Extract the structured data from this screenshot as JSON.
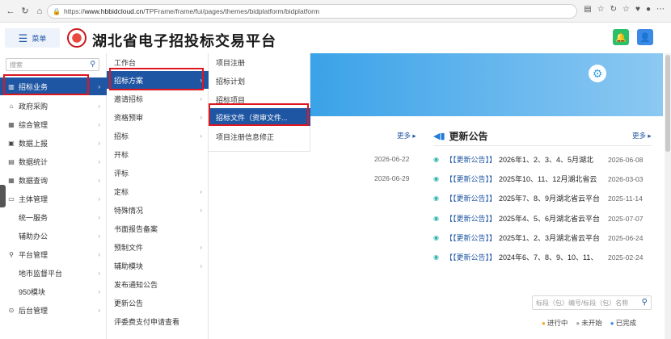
{
  "browser": {
    "nav": [
      "←",
      "↻",
      "⌂"
    ],
    "url_prefix": "https://",
    "url_host": "www.hbbidcloud.cn",
    "url_path": "/TPFrame/frame/fui/pages/themes/bidplatform/bidplatform",
    "right_icons": [
      "▤",
      "☆",
      "↻",
      "☆",
      "♥",
      "●",
      "⋯"
    ]
  },
  "header": {
    "menu_label": "菜单",
    "title": "湖北省电子招投标交易平台"
  },
  "sidebar": {
    "search_placeholder": "搜索",
    "items": [
      {
        "icon": "▥",
        "label": "招标业务",
        "arrow": "›",
        "active": true
      },
      {
        "icon": "⌂",
        "label": "政府采购",
        "arrow": "›"
      },
      {
        "icon": "▦",
        "label": "综合管理",
        "arrow": "›"
      },
      {
        "icon": "▣",
        "label": "数据上报",
        "arrow": "›"
      },
      {
        "icon": "▤",
        "label": "数据统计",
        "arrow": "›"
      },
      {
        "icon": "▦",
        "label": "数据查询",
        "arrow": "›"
      },
      {
        "icon": "▭",
        "label": "主体管理",
        "arrow": "›"
      },
      {
        "icon": "",
        "label": "统一服务",
        "arrow": "›",
        "sub": true
      },
      {
        "icon": "",
        "label": "辅助办公",
        "arrow": "›",
        "sub": true
      },
      {
        "icon": "⚲",
        "label": "平台管理",
        "arrow": "›"
      },
      {
        "icon": "",
        "label": "地市监督平台",
        "arrow": "›",
        "sub": true
      },
      {
        "icon": "",
        "label": "950模块",
        "arrow": "›",
        "sub": true
      },
      {
        "icon": "⊙",
        "label": "后台管理",
        "arrow": "›"
      }
    ]
  },
  "submenu": {
    "items": [
      {
        "label": "工作台",
        "arrow": ""
      },
      {
        "label": "招标方案",
        "arrow": "›",
        "active": true
      },
      {
        "label": "邀请招标",
        "arrow": "›"
      },
      {
        "label": "资格预审",
        "arrow": "›"
      },
      {
        "label": "招标",
        "arrow": "›"
      },
      {
        "label": "开标",
        "arrow": ""
      },
      {
        "label": "评标",
        "arrow": ""
      },
      {
        "label": "定标",
        "arrow": "›"
      },
      {
        "label": "特殊情况",
        "arrow": "›"
      },
      {
        "label": "书面报告备案",
        "arrow": ""
      },
      {
        "label": "预制文件",
        "arrow": "›"
      },
      {
        "label": "辅助模块",
        "arrow": "›"
      },
      {
        "label": "发布通知公告",
        "arrow": ""
      },
      {
        "label": "更新公告",
        "arrow": ""
      },
      {
        "label": "评委费支付申请查看",
        "arrow": ""
      }
    ]
  },
  "submenu3": {
    "items": [
      {
        "label": "项目注册"
      },
      {
        "label": "招标计划"
      },
      {
        "label": "招标项目"
      },
      {
        "label": "招标文件（资审文件...",
        "active": true
      },
      {
        "label": "项目注册信息修正"
      }
    ]
  },
  "notices": {
    "more_label": "更多 ▸",
    "title": "更新公告",
    "left_dates": [
      "2026-06-22",
      "2026-06-29"
    ],
    "rows": [
      {
        "tag": "【【更新公告】】",
        "text": "2026年1、2、3、4、5月湖北",
        "date": "2026-06-08"
      },
      {
        "tag": "【【更新公告】】",
        "text": "2025年10、11、12月湖北省云",
        "date": "2026-03-03"
      },
      {
        "tag": "【【更新公告】】",
        "text": "2025年7、8、9月湖北省云平台",
        "date": "2025-11-14"
      },
      {
        "tag": "【【更新公告】】",
        "text": "2025年4、5、6月湖北省云平台",
        "date": "2025-07-07"
      },
      {
        "tag": "【【更新公告】】",
        "text": "2025年1、2、3月湖北省云平台",
        "date": "2025-06-24"
      },
      {
        "tag": "【【更新公告】】",
        "text": "2024年6、7、8、9、10、11、",
        "date": "2025-02-24"
      }
    ]
  },
  "filter": {
    "search_placeholder": "标段（包）编号/标段（包）名称"
  },
  "legend": [
    {
      "label": "进行中",
      "color": "#f5a623"
    },
    {
      "label": "未开始",
      "color": "#aaaaaa"
    },
    {
      "label": "已完成",
      "color": "#3c8ae6"
    }
  ],
  "colors": {
    "primary": "#1f56a3",
    "highlight": "#e0161f",
    "banner": "#3aa2e8"
  }
}
